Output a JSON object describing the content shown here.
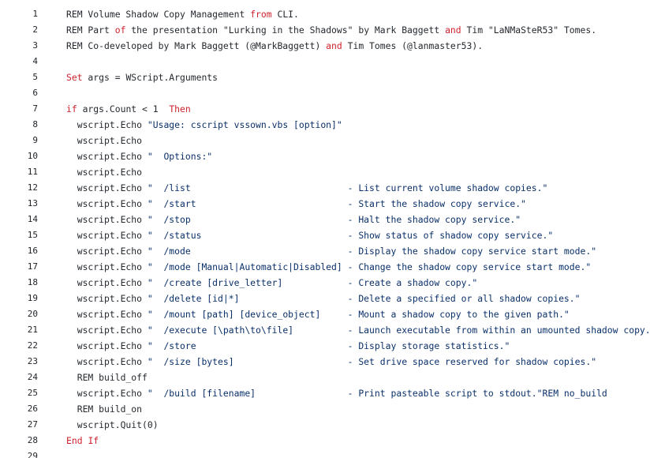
{
  "lines": [
    {
      "n": "1",
      "tokens": [
        {
          "t": "REM Volume Shadow Copy Management "
        },
        {
          "t": "from",
          "c": "kw"
        },
        {
          "t": " CLI."
        }
      ]
    },
    {
      "n": "2",
      "tokens": [
        {
          "t": "REM Part "
        },
        {
          "t": "of",
          "c": "kw"
        },
        {
          "t": " the presentation \"Lurking in the Shadows\" by Mark Baggett "
        },
        {
          "t": "and",
          "c": "kw"
        },
        {
          "t": " Tim \"LaNMaSteR53\" Tomes."
        }
      ]
    },
    {
      "n": "3",
      "tokens": [
        {
          "t": "REM Co-developed by Mark Baggett (@MarkBaggett) "
        },
        {
          "t": "and",
          "c": "kw"
        },
        {
          "t": " Tim Tomes (@lanmaster53)."
        }
      ]
    },
    {
      "n": "4",
      "tokens": []
    },
    {
      "n": "5",
      "tokens": [
        {
          "t": "Set",
          "c": "kw"
        },
        {
          "t": " args = WScript.Arguments"
        }
      ]
    },
    {
      "n": "6",
      "tokens": []
    },
    {
      "n": "7",
      "tokens": [
        {
          "t": "if",
          "c": "kw"
        },
        {
          "t": " args.Count < 1  "
        },
        {
          "t": "Then",
          "c": "kw"
        }
      ]
    },
    {
      "n": "8",
      "tokens": [
        {
          "t": "  wscript.Echo "
        },
        {
          "t": "\"Usage: cscript vssown.vbs [option]\"",
          "c": "str"
        }
      ]
    },
    {
      "n": "9",
      "tokens": [
        {
          "t": "  wscript.Echo"
        }
      ]
    },
    {
      "n": "10",
      "tokens": [
        {
          "t": "  wscript.Echo "
        },
        {
          "t": "\"  Options:\"",
          "c": "str"
        }
      ]
    },
    {
      "n": "11",
      "tokens": [
        {
          "t": "  wscript.Echo"
        }
      ]
    },
    {
      "n": "12",
      "tokens": [
        {
          "t": "  wscript.Echo "
        },
        {
          "t": "\"  /list                             - List current volume shadow copies.\"",
          "c": "str"
        }
      ]
    },
    {
      "n": "13",
      "tokens": [
        {
          "t": "  wscript.Echo "
        },
        {
          "t": "\"  /start                            - Start the shadow copy service.\"",
          "c": "str"
        }
      ]
    },
    {
      "n": "14",
      "tokens": [
        {
          "t": "  wscript.Echo "
        },
        {
          "t": "\"  /stop                             - Halt the shadow copy service.\"",
          "c": "str"
        }
      ]
    },
    {
      "n": "15",
      "tokens": [
        {
          "t": "  wscript.Echo "
        },
        {
          "t": "\"  /status                           - Show status of shadow copy service.\"",
          "c": "str"
        }
      ]
    },
    {
      "n": "16",
      "tokens": [
        {
          "t": "  wscript.Echo "
        },
        {
          "t": "\"  /mode                             - Display the shadow copy service start mode.\"",
          "c": "str"
        }
      ]
    },
    {
      "n": "17",
      "tokens": [
        {
          "t": "  wscript.Echo "
        },
        {
          "t": "\"  /mode [Manual|Automatic|Disabled] - Change the shadow copy service start mode.\"",
          "c": "str"
        }
      ]
    },
    {
      "n": "18",
      "tokens": [
        {
          "t": "  wscript.Echo "
        },
        {
          "t": "\"  /create [drive_letter]            - Create a shadow copy.\"",
          "c": "str"
        }
      ]
    },
    {
      "n": "19",
      "tokens": [
        {
          "t": "  wscript.Echo "
        },
        {
          "t": "\"  /delete [id|*]                    - Delete a specified or all shadow copies.\"",
          "c": "str"
        }
      ]
    },
    {
      "n": "20",
      "tokens": [
        {
          "t": "  wscript.Echo "
        },
        {
          "t": "\"  /mount [path] [device_object]     - Mount a shadow copy to the given path.\"",
          "c": "str"
        }
      ]
    },
    {
      "n": "21",
      "tokens": [
        {
          "t": "  wscript.Echo "
        },
        {
          "t": "\"  /execute [\\path\\to\\file]          - Launch executable from within an umounted shadow copy.\"",
          "c": "str"
        }
      ]
    },
    {
      "n": "22",
      "tokens": [
        {
          "t": "  wscript.Echo "
        },
        {
          "t": "\"  /store                            - Display storage statistics.\"",
          "c": "str"
        }
      ]
    },
    {
      "n": "23",
      "tokens": [
        {
          "t": "  wscript.Echo "
        },
        {
          "t": "\"  /size [bytes]                     - Set drive space reserved for shadow copies.\"",
          "c": "str"
        }
      ]
    },
    {
      "n": "24",
      "tokens": [
        {
          "t": "  REM build_off"
        }
      ]
    },
    {
      "n": "25",
      "tokens": [
        {
          "t": "  wscript.Echo "
        },
        {
          "t": "\"  /build [filename]                 - Print pasteable script to stdout.\"REM no_build",
          "c": "str"
        }
      ]
    },
    {
      "n": "26",
      "tokens": [
        {
          "t": "  REM build_on"
        }
      ]
    },
    {
      "n": "27",
      "tokens": [
        {
          "t": "  wscript.Quit(0)"
        }
      ]
    },
    {
      "n": "28",
      "tokens": [
        {
          "t": "End",
          "c": "kw"
        },
        {
          "t": " "
        },
        {
          "t": "If",
          "c": "kw"
        }
      ]
    },
    {
      "n": "29",
      "tokens": []
    }
  ],
  "colors": {
    "keyword": "#cf222e",
    "string": "#0a3069",
    "text": "#24292f",
    "background": "#ffffff"
  }
}
